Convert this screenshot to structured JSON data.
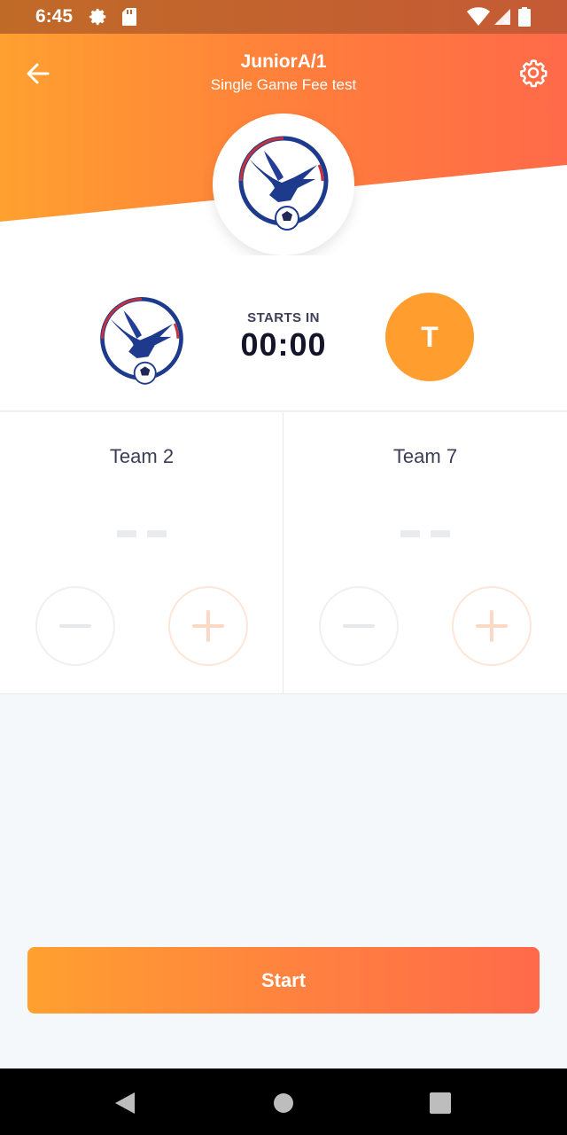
{
  "status_bar": {
    "time": "6:45",
    "icons": [
      "settings-gear-icon",
      "sd-card-icon",
      "wifi-icon",
      "signal-icon",
      "battery-icon"
    ]
  },
  "header": {
    "title": "JuniorA/1",
    "subtitle": "Single Game Fee test",
    "back_icon": "arrow-left-icon",
    "settings_icon": "gear-icon",
    "gradient_start": "#ffa030",
    "gradient_end": "#ff6a4a"
  },
  "match": {
    "starts_label": "STARTS IN",
    "timer": "00:00",
    "away_initial": "T",
    "away_color": "#ff9d2e"
  },
  "teams": [
    {
      "name": "Team 2",
      "score": "– –",
      "minus_icon": "minus-icon",
      "plus_icon": "plus-icon"
    },
    {
      "name": "Team 7",
      "score": "– –",
      "minus_icon": "minus-icon",
      "plus_icon": "plus-icon"
    }
  ],
  "actions": {
    "start_label": "Start"
  },
  "nav": {
    "icons": [
      "back-triangle-icon",
      "home-circle-icon",
      "recents-square-icon"
    ]
  }
}
